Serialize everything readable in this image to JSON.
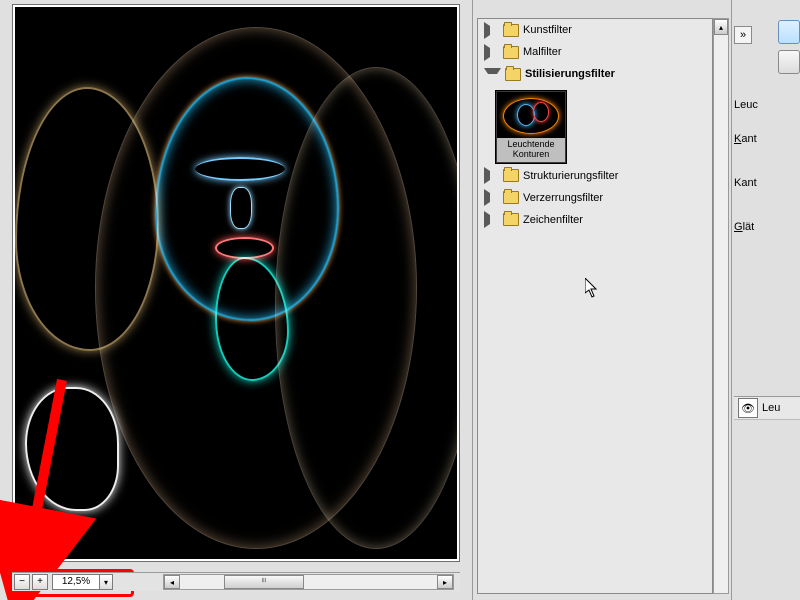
{
  "preview": {
    "zoom_value": "12,5%"
  },
  "tree": {
    "categories": [
      {
        "label": "Kunstfilter",
        "expanded": false
      },
      {
        "label": "Malfilter",
        "expanded": false
      },
      {
        "label": "Stilisierungsfilter",
        "expanded": true
      },
      {
        "label": "Strukturierungsfilter",
        "expanded": false
      },
      {
        "label": "Verzerrungsfilter",
        "expanded": false
      },
      {
        "label": "Zeichenfilter",
        "expanded": false
      }
    ],
    "stilisierung_thumbs": [
      {
        "label": "Leuchtende\nKonturen",
        "selected": true
      }
    ]
  },
  "params": {
    "title": "Leuc",
    "line1_prefix": "K",
    "line1_rest": "ant",
    "line2": "Kant",
    "line3_prefix": "G",
    "line3_rest": "lät"
  },
  "layer_row_label": "Leu",
  "icons": {
    "minus": "−",
    "plus": "+",
    "down": "▾",
    "left": "◂",
    "right": "▸",
    "up": "▴",
    "eye": "👁"
  }
}
